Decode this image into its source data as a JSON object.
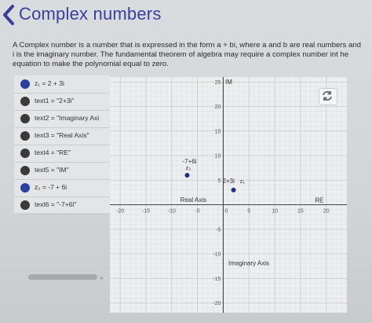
{
  "header": {
    "title": "Complex numbers"
  },
  "description": {
    "line1": "A Complex number is a number that is expressed in the form a + bi, where a and b are real numbers and",
    "line2": "i is the imaginary number. The fundamental theorem of algebra may require a complex number int he",
    "line3": "equation to make the polynomial equal to zero."
  },
  "expressions": [
    {
      "text": "z₁ = 2 + 3i",
      "color": "#2d3f9e"
    },
    {
      "text": "text1 = \"2+3i\"",
      "color": "#3a3a3a"
    },
    {
      "text": "text2 = \"Imaginary Axi",
      "color": "#3a3a3a"
    },
    {
      "text": "text3 = \"Real Axis\"",
      "color": "#3a3a3a"
    },
    {
      "text": "text4 = \"RE\"",
      "color": "#3a3a3a"
    },
    {
      "text": "text5 = \"IM\"",
      "color": "#3a3a3a"
    },
    {
      "text": "z₂ = -7 + 6i",
      "color": "#2d3f9e"
    },
    {
      "text": "text6 = \"-7+6i\"",
      "color": "#3a3a3a"
    }
  ],
  "chart_data": {
    "type": "scatter",
    "points": [
      {
        "x": 2,
        "y": 3,
        "label": "2+3i",
        "sub_label": "z₁"
      },
      {
        "x": -7,
        "y": 6,
        "label": "-7+6i",
        "sub_label": "z₂"
      }
    ],
    "axis_texts": {
      "real_axis": "Real Axis",
      "imaginary_axis": "Imaginary Axis",
      "re": "RE",
      "im": "IM"
    },
    "x_ticks": [
      "-20",
      "-15",
      "-10",
      "-5",
      "0",
      "5",
      "10",
      "15",
      "20"
    ],
    "x_tick_values": [
      -20,
      -15,
      -10,
      -5,
      0,
      5,
      10,
      15,
      20
    ],
    "y_ticks": [
      "25",
      "20",
      "15",
      "10",
      "5",
      "-5",
      "-10",
      "-15",
      "-20"
    ],
    "y_tick_values": [
      25,
      20,
      15,
      10,
      5,
      -5,
      -10,
      -15,
      -20
    ],
    "xlim": [
      -22,
      24
    ],
    "ylim": [
      -22,
      26
    ],
    "grid": true,
    "point_color": "#1f2f8a"
  },
  "colors": {
    "accent": "#3b3f9a"
  },
  "icons": {
    "header": "chevron-left-icon",
    "reset": "reset-arrows-icon"
  }
}
